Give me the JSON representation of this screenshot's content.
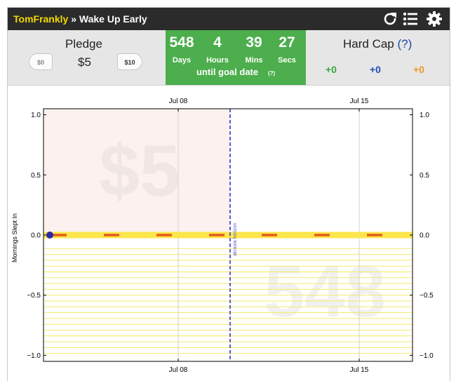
{
  "header": {
    "user": "TomFrankly",
    "separator": "»",
    "goal_title": "Wake Up Early",
    "icons": {
      "refresh": "refresh-icon",
      "list": "list-icon",
      "settings": "gear-icon"
    }
  },
  "pledge": {
    "label": "Pledge",
    "amount": "$5",
    "decrease_label": "$0",
    "increase_label": "$10"
  },
  "countdown": {
    "days": "548",
    "days_label": "Days",
    "hours": "4",
    "hours_label": "Hours",
    "mins": "39",
    "mins_label": "Mins",
    "secs": "27",
    "secs_label": "Secs",
    "until_text": "until goal date",
    "help": "(?)"
  },
  "hard_cap": {
    "label": "Hard Cap",
    "help": "(?)",
    "values": [
      "+0",
      "+0",
      "+0"
    ],
    "colors": [
      "#3aa63a",
      "#1f4fb8",
      "#f0961e"
    ]
  },
  "chart_data": {
    "type": "line",
    "ylabel": "Mornings Slept In",
    "xlabel": "",
    "x_ticks": [
      "Jul 08",
      "Jul 15"
    ],
    "ylim": [
      -1.05,
      1.05
    ],
    "y_ticks_left": [
      "1.0",
      "0.5",
      "0.0",
      "−0.5",
      "−1.0"
    ],
    "y_ticks_right": [
      "1.0",
      "0.5",
      "0.0",
      "−0.5",
      "−1.0"
    ],
    "y_tick_values": [
      1.0,
      0.5,
      0.0,
      -0.5,
      -1.0
    ],
    "watermark_pledge": "$5",
    "watermark_days": "548",
    "horizon_label": "akrasia horizon",
    "datapoints": [
      {
        "x": "start",
        "y": 0
      }
    ],
    "road_value": 0,
    "colors": {
      "road": "#fde64b",
      "dashes": "#e45c1e",
      "horizon": "#5a5ad6",
      "datapoint": "#2a2aa8",
      "safe_lines": "#f2ea6a",
      "past_region": "#fdf1ef"
    }
  }
}
